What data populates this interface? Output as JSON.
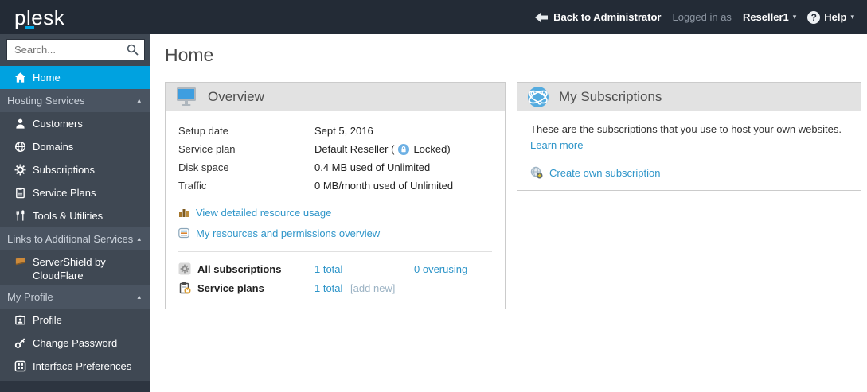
{
  "topbar": {
    "logo": "plesk",
    "back_label": "Back to Administrator",
    "logged_in_as": "Logged in as",
    "username": "Reseller1",
    "help_label": "Help"
  },
  "icons": {
    "caret_down": "▾",
    "caret_up": "▴",
    "help_glyph": "?"
  },
  "sidebar": {
    "search_placeholder": "Search...",
    "home_label": "Home",
    "group_hosting": "Hosting Services",
    "customers": "Customers",
    "domains": "Domains",
    "subscriptions": "Subscriptions",
    "service_plans": "Service Plans",
    "tools": "Tools & Utilities",
    "group_links": "Links to Additional Services",
    "servershield": "ServerShield by CloudFlare",
    "group_profile": "My Profile",
    "profile": "Profile",
    "change_password": "Change Password",
    "interface_preferences": "Interface Preferences"
  },
  "page": {
    "title": "Home"
  },
  "overview": {
    "title": "Overview",
    "setup_date_label": "Setup date",
    "setup_date_value": "Sept 5, 2016",
    "service_plan_label": "Service plan",
    "service_plan_prefix": "Default Reseller (",
    "service_plan_locked": "Locked)",
    "disk_space_label": "Disk space",
    "disk_space_value": "0.4 MB used of Unlimited",
    "traffic_label": "Traffic",
    "traffic_value": "0 MB/month used of Unlimited",
    "link_resource_usage": "View detailed resource usage",
    "link_permissions": "My resources and permissions overview",
    "all_subscriptions_label": "All subscriptions",
    "all_subscriptions_total": "1 total",
    "all_subscriptions_overusing": "0 overusing",
    "service_plans_label": "Service plans",
    "service_plans_total": "1 total",
    "service_plans_add_new": "[add new]"
  },
  "subscriptions_panel": {
    "title": "My Subscriptions",
    "description": "These are the subscriptions that you use to host your own websites.",
    "learn_more": "Learn more",
    "create_label": "Create own subscription"
  },
  "colors": {
    "accent_blue": "#00a2e0",
    "link_blue": "#2e95c9",
    "topbar_bg": "#232b36",
    "sidebar_bg": "#3f4853",
    "panel_header_bg": "#e2e2e2"
  }
}
